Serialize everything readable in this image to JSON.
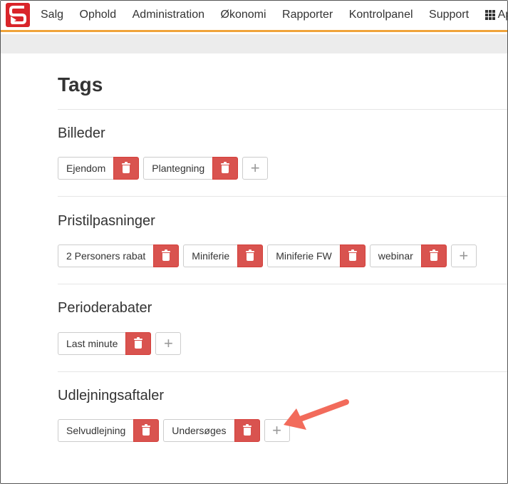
{
  "nav": {
    "items": [
      "Salg",
      "Ophold",
      "Administration",
      "Økonomi",
      "Rapporter",
      "Kontrolpanel",
      "Support"
    ],
    "apps_label": "Apps"
  },
  "page": {
    "title": "Tags"
  },
  "sections": [
    {
      "title": "Billeder",
      "tags": [
        "Ejendom",
        "Plantegning"
      ]
    },
    {
      "title": "Pristilpasninger",
      "tags": [
        "2 Personers rabat",
        "Miniferie",
        "Miniferie FW",
        "webinar"
      ]
    },
    {
      "title": "Perioderabater",
      "tags": [
        "Last minute"
      ]
    },
    {
      "title": "Udlejningsaftaler",
      "tags": [
        "Selvudlejning",
        "Undersøges"
      ]
    }
  ],
  "icons": {
    "delete": "trash-icon",
    "add": "plus-icon",
    "apps": "grid-icon",
    "logo": "logo-icon"
  },
  "colors": {
    "accent": "#f0a33a",
    "danger": "#d9534f",
    "logo": "#d9252a",
    "arrow": "#f26b5b"
  },
  "add_symbol": "+"
}
